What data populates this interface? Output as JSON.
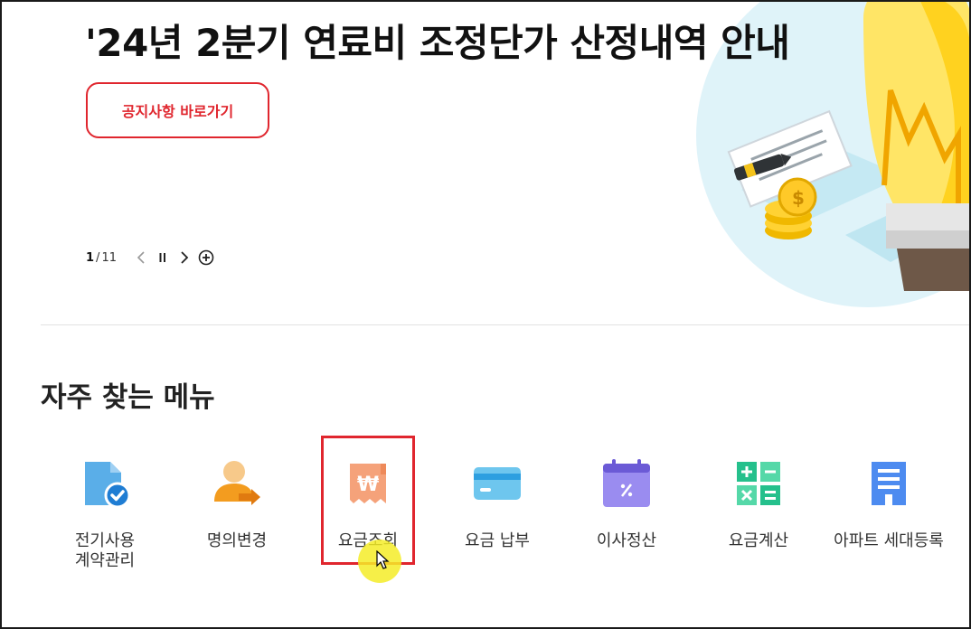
{
  "banner": {
    "title": "'24년 2분기 연료비 조정단가 산정내역 안내",
    "button_label": "공지사항 바로가기",
    "pager": {
      "current": "1",
      "separator": "/",
      "total": "11"
    }
  },
  "favorites": {
    "title": "자주 찾는 메뉴",
    "items": [
      {
        "label": "전기사용\n계약관리",
        "icon": "contract-document-check-icon"
      },
      {
        "label": "명의변경",
        "icon": "user-transfer-icon"
      },
      {
        "label": "요금조회",
        "icon": "won-receipt-icon"
      },
      {
        "label": "요금 납부",
        "icon": "credit-card-icon"
      },
      {
        "label": "이사정산",
        "icon": "calendar-percent-icon"
      },
      {
        "label": "요금계산",
        "icon": "calculator-icon"
      },
      {
        "label": "아파트 세대등록",
        "icon": "apartment-building-icon"
      }
    ]
  },
  "colors": {
    "accent": "#e0262e",
    "highlight": "#f5ec28"
  }
}
